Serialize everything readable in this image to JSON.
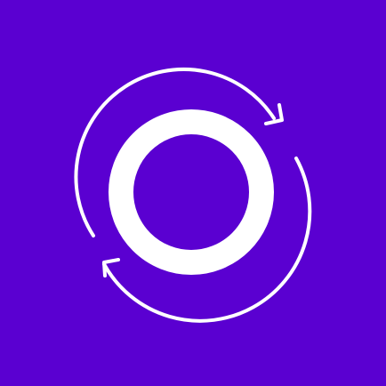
{
  "icon": {
    "name": "sync-ring-logo-icon",
    "colors": {
      "background": "#5a00d1",
      "foreground": "#ffffff"
    }
  }
}
